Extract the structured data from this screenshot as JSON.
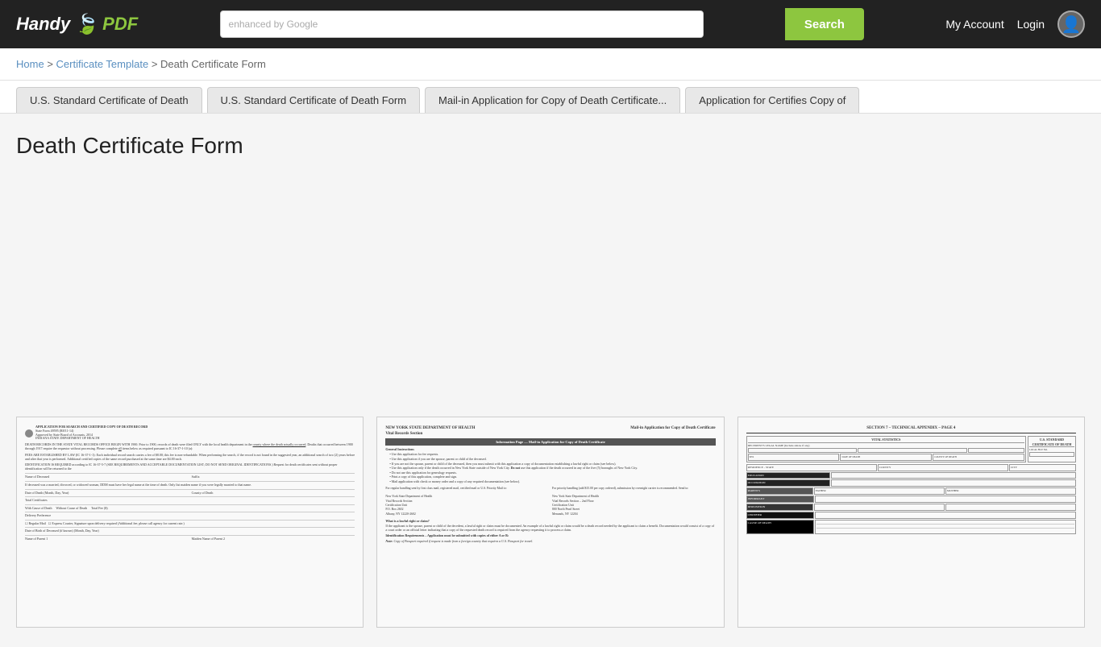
{
  "header": {
    "logo_handy": "Handy",
    "logo_pdf": "PDF",
    "search_label": "enhanced by Google",
    "search_placeholder": "",
    "search_button": "Search",
    "nav_my_account": "My Account",
    "nav_login": "Login"
  },
  "breadcrumb": {
    "home": "Home",
    "separator1": ">",
    "cert_template": "Certificate Template",
    "separator2": ">",
    "current": "Death Certificate Form"
  },
  "tabs": [
    {
      "id": "tab1",
      "label": "U.S. Standard Certificate of Death"
    },
    {
      "id": "tab2",
      "label": "U.S. Standard Certificate of Death Form"
    },
    {
      "id": "tab3",
      "label": "Mail-in Application for Copy of Death Certificate..."
    },
    {
      "id": "tab4",
      "label": "Application for Certifies Copy of"
    }
  ],
  "page": {
    "title": "Death Certificate Form"
  },
  "docs": [
    {
      "id": "doc1",
      "header": "APPLICATION FOR SEARCH AND CERTIFIED COPY OF DEATH RECORD",
      "subheader": "State Form 49595 (R8/11-14)\nApproved by State Board of Accounts, 2014\nINDIANA STATE DEPARTMENT OF HEALTH",
      "body_lines": [
        "DEATH RECORDS IN THE STATE VITAL RECORDS OFFICE BEGIN WITH 1900. Prior to 1900, records of death were filed ONLY with",
        "the local health department in the county where the death actually occurred. Deaths that occurred between 1900 through 1917 require the",
        "requestor without processing. Please complete all items below as required pursuant to IC 16-37-1-10 (a):",
        "",
        "FEES ARE ESTABLISHED BY LAW (IC 16-37-1-1): Each individual record search carries a fee of $8.00; this fee is non-refundable. When",
        "performing the search, if the record is not found in the suggested year, an additional search of two (2) years before and after that year is",
        "performed. Additional certified copies of the same record purchased at the same time are $4.00 each.",
        "",
        "IDENTIFICATION IS REQUIRED according to IC 16-37-5-7 (SEE REQUIREMENTS AND ACCEPTABLE DOCUMENTATION LIST;",
        "DO NOT SEND ORIGINAL IDENTIFICATIONS.)"
      ],
      "fields": [
        "Name of Deceased",
        "Suffix",
        "Yes  No",
        "Date of Death (Month, Day, Year)",
        "County of Death",
        "Total Certificates",
        "With Cause of Death    Without Cause of Death    Total Fee ($)",
        "Delivery Preference",
        "Regular Mail   Express Courier, Signature upon delivery required",
        "Date of Birth of Deceased (if known) (Month, Day, Year)",
        "Name of Parent 1",
        "Maiden Name of Parent 2"
      ]
    },
    {
      "id": "doc2",
      "agency": "NEW YORK STATE DEPARTMENT OF HEALTH",
      "agency_sub": "Vital Records Section",
      "form_title": "Mail-in Application for Copy of Death Certificate",
      "info_section": "Information Page — Mail-in Application for Copy of Death Certificate",
      "general_instructions": "General Instructions",
      "bullets": [
        "Use this application for fee requests.",
        "Use this application if you are the spouse, parent or child of the deceased.",
        "If you are not the spouse, parent or child of the deceased, then you must submit with this application a copy of documentation establishing a lawful right or claim (see below).",
        "Use this application only if the death occurred in New York State outside of New York City. Do not use this application if the death occurred in any of the five (5) boroughs of New York City.",
        "Do not use this application for genealogy requests.",
        "Print a copy of this application, complete and sign.",
        "Mail application with check or money order and a copy of any required documentation (see below)."
      ],
      "col1_header": "For regular handling sent by first class mail, registered mail, certified mail or U.S. Priority Mail to:",
      "col1_addr": "New York State Department of Health\nVital Records Section\nCertification Unit\nP.O. Box 2602\nAlbany, NY 12220-2602",
      "col2_header": "For priority handling (add $15.00 per copy ordered), submission by overnight carrier is recommended. Send to:",
      "col2_addr": "New York State Department of Health\nVital Records Section – 2nd Floor\nCertification Unit\n800 North Pearl Street\nMenands, NY 12204",
      "lawful_header": "What is a lawful right or claim?",
      "lawful_body": "If the applicant is the spouse, parent or child of the decedent, a lawful right or claim must be documented. An example of a lawful right or claim would be a death record needed by the applicant to claim a benefit. Documentation would consist of a copy of a court order or an official letter indicating that a copy of the requested death record is required from the agency requesting it to process a claim.",
      "id_req_header": "Identification Requirements – Application must be submitted with copies of either A or B:",
      "id_req_note": "Note: Copy of Passport required if request is made from a foreign country that requires a U.S. Passport for travel."
    },
    {
      "id": "doc3",
      "section_label": "SECTION 7 – TECHNICAL APPENDIX – PAGE 4",
      "form_title": "U.S. STANDARD\nCERTIFICATE OF DEATH"
    }
  ]
}
